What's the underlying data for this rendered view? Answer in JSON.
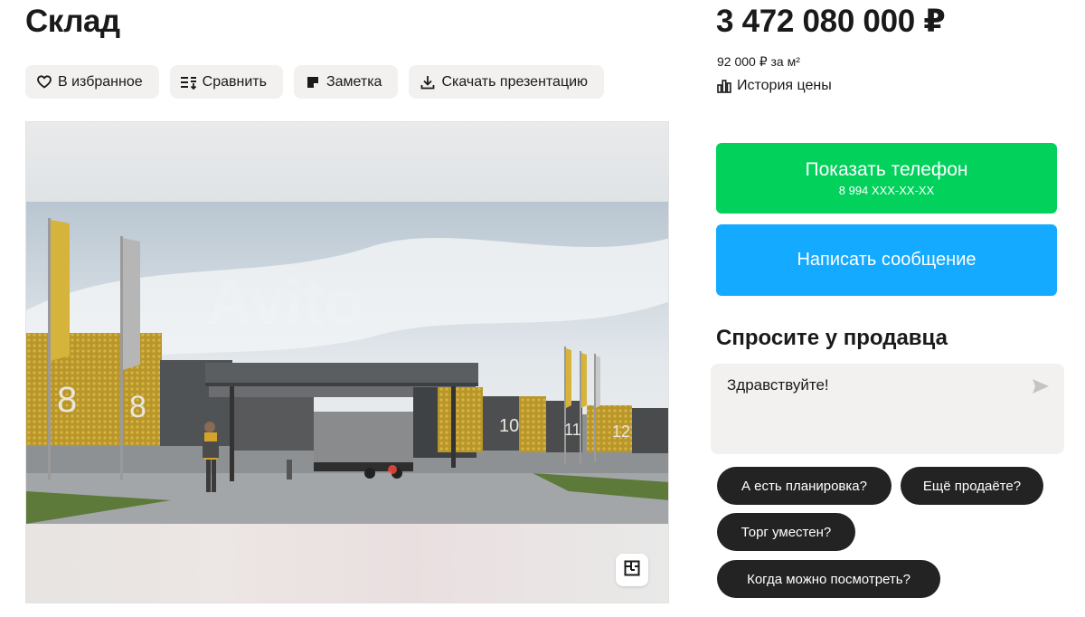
{
  "listing": {
    "title": "Склад",
    "price": "3 472 080 000 ₽",
    "price_per_m": "92 000 ₽ за м²",
    "price_history_label": "История цены"
  },
  "actions": {
    "favorite_label": "В избранное",
    "compare_label": "Сравнить",
    "note_label": "Заметка",
    "download_label": "Скачать презентацию"
  },
  "contact": {
    "show_phone_label": "Показать телефон",
    "phone_masked": "8 994 XXX-XX-XX",
    "write_message_label": "Написать сообщение"
  },
  "ask_seller": {
    "title": "Спросите у продавца",
    "input_value": "Здравствуйте!",
    "quick_questions": [
      "А есть планировка?",
      "Ещё продаёте?",
      "Торг уместен?",
      "Когда можно посмотреть?"
    ]
  },
  "gallery": {
    "building_numbers": [
      "8",
      "8",
      "10",
      "11",
      "12"
    ],
    "watermark": "Avito"
  },
  "colors": {
    "phone_button": "#02d15c",
    "message_button": "#14aaff",
    "chip_bg": "#232323",
    "action_bg": "#f2f1f0"
  }
}
